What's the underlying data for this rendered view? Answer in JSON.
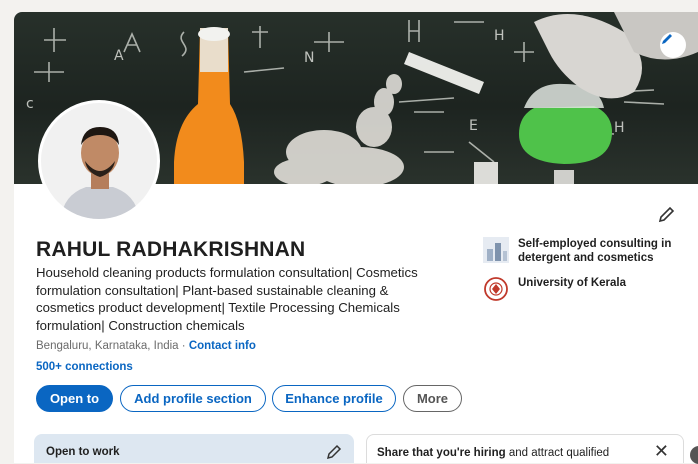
{
  "profile": {
    "name": "RAHUL RADHAKRISHNAN",
    "headline": "Household cleaning products formulation consultation| Cosmetics formulation consultation| Plant-based sustainable cleaning & cosmetics product development| Textile Processing Chemicals formulation| Construction chemicals",
    "location": "Bengaluru, Karnataka, India",
    "location_sep": " · ",
    "contact_info": "Contact info",
    "connections": "500+ connections"
  },
  "actions": {
    "open_to": "Open to",
    "add_profile_section": "Add profile section",
    "enhance_profile": "Enhance profile",
    "more": "More"
  },
  "organizations": [
    {
      "name": "Self-employed consulting in detergent and cosmetics",
      "icon": "company-logo-icon"
    },
    {
      "name": "University of Kerala",
      "icon": "university-seal-icon"
    }
  ],
  "open_to_work": {
    "title": "Open to work"
  },
  "hiring": {
    "bold": "Share that you're hiring",
    "rest": " and attract qualified"
  },
  "colors": {
    "accent": "#0a66c2",
    "open_to_work_bg": "#dde7f1"
  },
  "icons": {
    "edit": "pencil-icon",
    "close": "close-icon"
  }
}
